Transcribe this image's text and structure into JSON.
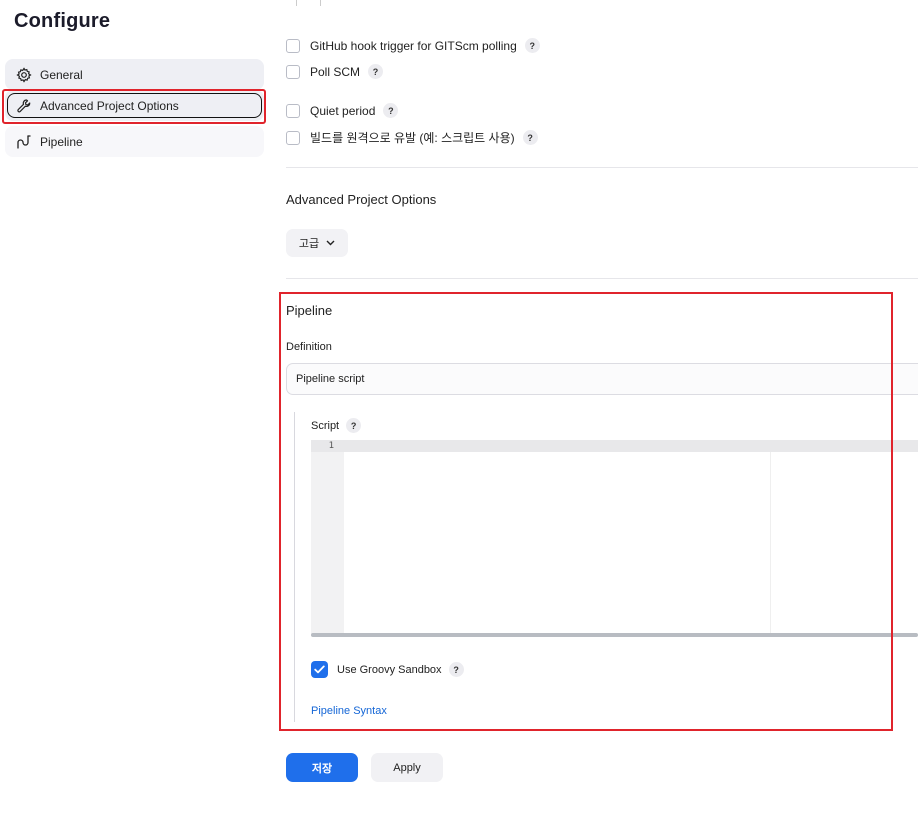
{
  "page": {
    "title": "Configure"
  },
  "sidebar": {
    "items": [
      {
        "label": "General",
        "icon": "gear-icon"
      },
      {
        "label": "Advanced Project Options",
        "icon": "wrench-icon"
      },
      {
        "label": "Pipeline",
        "icon": "pipeline-icon"
      }
    ]
  },
  "triggers": {
    "github_hook": "GitHub hook trigger for GITScm polling",
    "poll_scm": "Poll SCM",
    "quiet_period": "Quiet period",
    "remote_trigger": "빌드를 원격으로 유발 (예: 스크립트 사용)"
  },
  "advanced": {
    "heading": "Advanced Project Options",
    "button_label": "고급"
  },
  "pipeline": {
    "heading": "Pipeline",
    "definition_label": "Definition",
    "definition_value": "Pipeline script",
    "script_label": "Script",
    "line_number": "1",
    "sandbox_label": "Use Groovy Sandbox",
    "sandbox_checked": true,
    "syntax_link": "Pipeline Syntax"
  },
  "buttons": {
    "save": "저장",
    "apply": "Apply"
  },
  "help_glyph": "?",
  "colors": {
    "accent": "#1f6feb",
    "highlight": "#e0242c",
    "link": "#1466d6"
  }
}
